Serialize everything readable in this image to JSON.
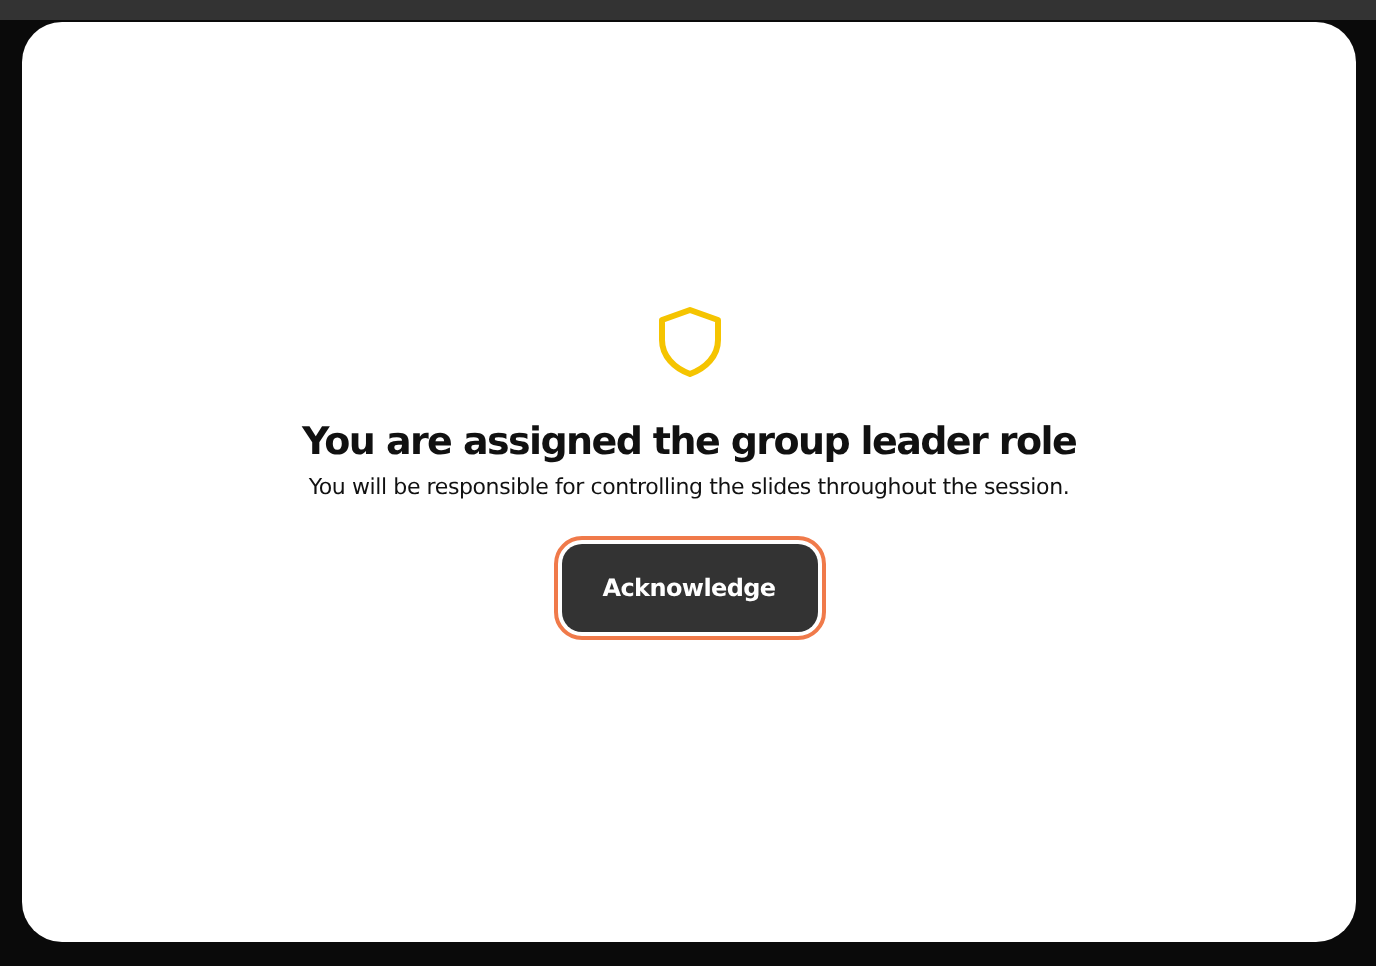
{
  "dialog": {
    "title": "You are assigned the group leader role",
    "message": "You will be responsible for controlling the slides throughout the session.",
    "button": {
      "label": "Acknowledge",
      "focused": true
    }
  }
}
